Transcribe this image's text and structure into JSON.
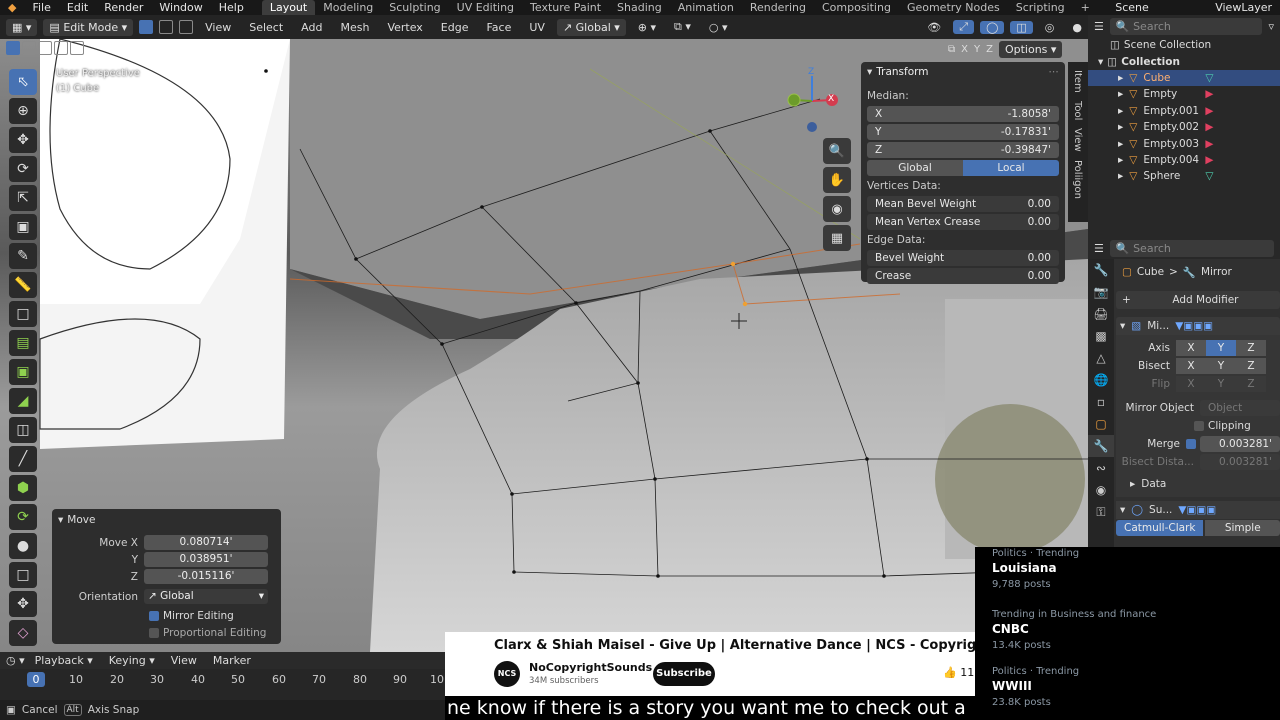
{
  "menubar": {
    "items": [
      "File",
      "Edit",
      "Render",
      "Window",
      "Help"
    ],
    "workspaces": [
      "Layout",
      "Modeling",
      "Sculpting",
      "UV Editing",
      "Texture Paint",
      "Shading",
      "Animation",
      "Rendering",
      "Compositing",
      "Geometry Nodes",
      "Scripting"
    ],
    "active_workspace": "Layout",
    "add_tab": "+",
    "scene": "Scene",
    "viewlayer": "ViewLayer"
  },
  "viewport_header": {
    "mode": "Edit Mode",
    "menus": [
      "View",
      "Select",
      "Add",
      "Mesh",
      "Vertex",
      "Edge",
      "Face",
      "UV"
    ],
    "orientation": "Global",
    "options": "Options",
    "axes": [
      "X",
      "Y",
      "Z"
    ]
  },
  "viewport": {
    "view_name": "User Perspective",
    "object_name": "(1) Cube",
    "gizmo": {
      "x": "X",
      "y": "Y",
      "z": "Z"
    }
  },
  "npanel": {
    "title": "Transform",
    "median_label": "Median:",
    "median": [
      {
        "axis": "X",
        "value": "-1.8058'"
      },
      {
        "axis": "Y",
        "value": "-0.17831'"
      },
      {
        "axis": "Z",
        "value": "-0.39847'"
      }
    ],
    "space_buttons": [
      "Global",
      "Local"
    ],
    "active_space": "Local",
    "vertices_label": "Vertices Data:",
    "vertices": [
      {
        "label": "Mean Bevel Weight",
        "value": "0.00"
      },
      {
        "label": "Mean Vertex Crease",
        "value": "0.00"
      }
    ],
    "edge_label": "Edge Data:",
    "edges": [
      {
        "label": "Bevel Weight",
        "value": "0.00"
      },
      {
        "label": "Crease",
        "value": "0.00"
      }
    ],
    "side_tabs": [
      "Item",
      "Tool",
      "View",
      "Poliigon"
    ]
  },
  "outliner": {
    "search_placeholder": "Search",
    "scene_collection": "Scene Collection",
    "collection": "Collection",
    "items": [
      {
        "name": "Cube",
        "selected": true
      },
      {
        "name": "Empty",
        "selected": false
      },
      {
        "name": "Empty.001",
        "selected": false
      },
      {
        "name": "Empty.002",
        "selected": false
      },
      {
        "name": "Empty.003",
        "selected": false
      },
      {
        "name": "Empty.004",
        "selected": false
      },
      {
        "name": "Sphere",
        "selected": false
      }
    ]
  },
  "properties": {
    "search_placeholder": "Search",
    "breadcrumb_object": "Cube",
    "breadcrumb_sep": ">",
    "breadcrumb_modifier": "Mirror",
    "add_modifier": "Add Modifier",
    "mirror_name": "Mi...",
    "axis_label": "Axis",
    "bisect_label": "Bisect",
    "flip_label": "Flip",
    "xyz": [
      "X",
      "Y",
      "Z"
    ],
    "mirror_object_label": "Mirror Object",
    "mirror_object_placeholder": "Object",
    "clipping_label": "Clipping",
    "merge_label": "Merge",
    "merge_value": "0.003281'",
    "bisect_distance_label": "Bisect Dista...",
    "bisect_distance_value": "0.003281'",
    "data_label": "Data",
    "subsurf_name": "Su...",
    "subsurf_modes": [
      "Catmull-Clark",
      "Simple"
    ]
  },
  "move_panel": {
    "title": "Move",
    "rows": [
      {
        "label": "Move X",
        "value": "0.080714'"
      },
      {
        "label": "Y",
        "value": "0.038951'"
      },
      {
        "label": "Z",
        "value": "-0.015116'"
      }
    ],
    "orientation_label": "Orientation",
    "orientation_value": "Global",
    "mirror_editing": "Mirror Editing",
    "proportional_editing": "Proportional Editing"
  },
  "timeline": {
    "menus": [
      "Playback",
      "Keying",
      "View",
      "Marker"
    ],
    "current_frame": "0",
    "ticks": [
      "10",
      "20",
      "30",
      "40",
      "50",
      "60",
      "70",
      "80",
      "90",
      "10"
    ]
  },
  "status": {
    "cancel": "Cancel",
    "alt_key": "Alt",
    "axis_snap": "Axis Snap"
  },
  "youtube": {
    "title": "Clarx & Shiah Maisel - Give Up | Alternative Dance | NCS - Copyright Free Music",
    "channel_logo": "NCS",
    "channel": "NoCopyrightSounds",
    "subscribers": "34M subscribers",
    "subscribe": "Subscribe",
    "likes": "11"
  },
  "trending": [
    {
      "category": "Politics · Trending",
      "topic": "Louisiana",
      "posts": "9,788 posts"
    },
    {
      "category": "Trending in Business and finance",
      "topic": "CNBC",
      "posts": "13.4K posts"
    },
    {
      "category": "Politics · Trending",
      "topic": "WWIII",
      "posts": "23.8K posts"
    }
  ],
  "caption": "ne know if there is a story you want me to check out a"
}
